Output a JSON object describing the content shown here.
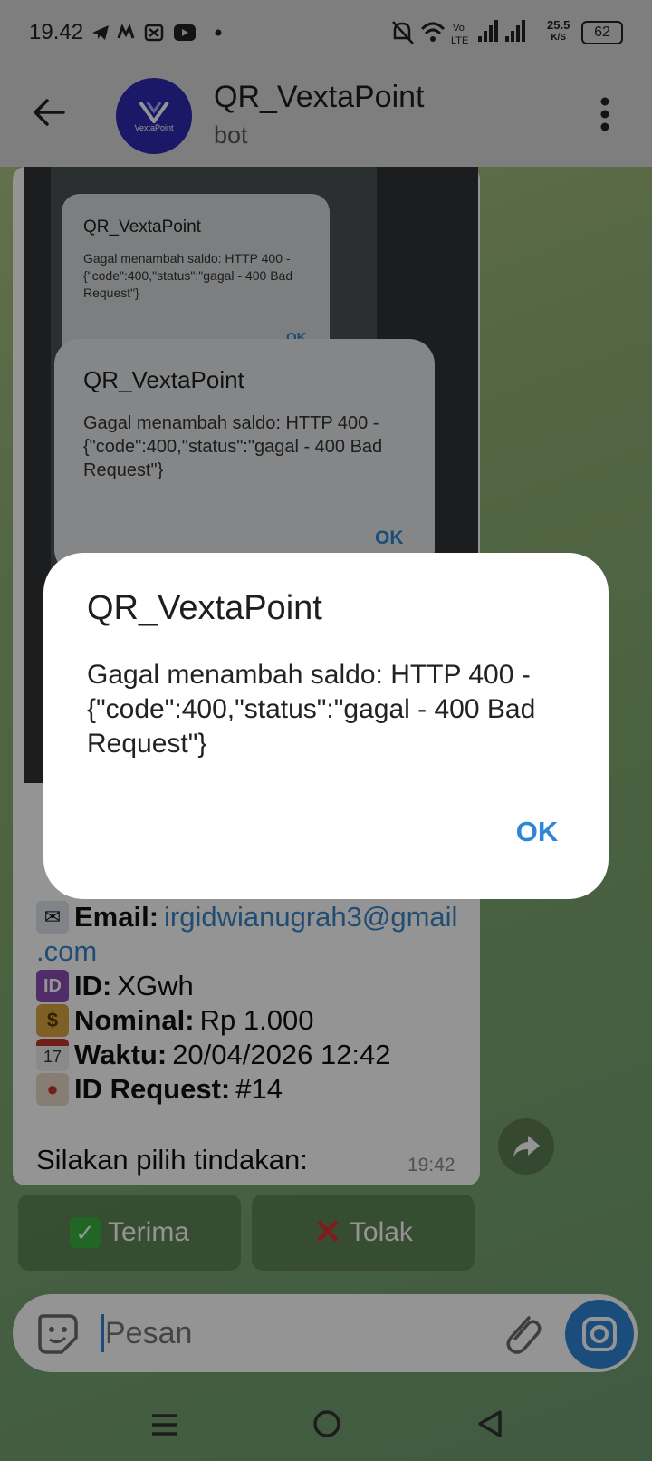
{
  "status_bar": {
    "time": "19.42",
    "icons": [
      "telegram-icon",
      "m-icon",
      "x-icon",
      "youtube-icon",
      "dot-icon"
    ],
    "right_icons": [
      "mute-icon",
      "wifi-icon",
      "volte-icon",
      "signal1-icon",
      "signal2-icon"
    ],
    "volte": "Vo LTE",
    "speed_value": "25.5",
    "speed_unit": "K/S",
    "battery": "62"
  },
  "app_bar": {
    "title": "QR_VextaPoint",
    "subtitle": "bot",
    "avatar_text": "VextaPoint"
  },
  "screenshot_image": {
    "dialog_back": {
      "title": "QR_VextaPoint",
      "line1": "Gagal menambah saldo: HTTP 400 -",
      "line2": "{\"code\":400,\"status\":\"gagal - 400 Bad",
      "line3": "Request\"}",
      "ok": "OK"
    },
    "dialog_mid": {
      "title": "QR_VextaPoint",
      "line1": "Gagal menambah saldo: HTTP 400 -",
      "line2": "{\"code\":400,\"status\":\"gagal - 400 Bad",
      "line3": "Request\"}",
      "ok": "OK"
    }
  },
  "message": {
    "email_label": "Email:",
    "email_value_1": "irgidwianugrah3@gmail",
    "email_value_2": ".com",
    "id_label": "ID:",
    "id_value": "XGwh",
    "nominal_label": "Nominal:",
    "nominal_value": "Rp 1.000",
    "waktu_label": "Waktu:",
    "waktu_value": "20/04/2026 12:42",
    "request_label": "ID Request:",
    "request_value": "#14",
    "prompt": "Silakan pilih tindakan:",
    "time": "19:42",
    "emoji_icons": [
      "envelope-icon",
      "id-icon",
      "money-bag-icon",
      "calendar-icon",
      "tag-icon"
    ],
    "calendar_day": "17"
  },
  "buttons": {
    "accept": "Terima",
    "reject": "Tolak",
    "accept_icon": "check-mark-icon",
    "reject_icon": "cross-mark-icon"
  },
  "input": {
    "placeholder": "Pesan"
  },
  "dialog": {
    "title": "QR_VextaPoint",
    "line1": "Gagal menambah saldo: HTTP 400 -",
    "line2": "{\"code\":400,\"status\":\"gagal - 400 Bad",
    "line3": "Request\"}",
    "ok": "OK"
  },
  "colors": {
    "accent": "#2f86d6",
    "link": "#3a85c9",
    "avatar": "#2f2ab4"
  }
}
